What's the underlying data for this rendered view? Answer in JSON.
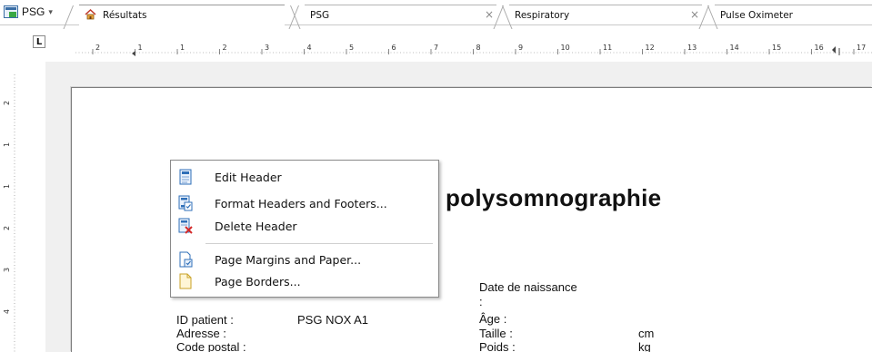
{
  "app": {
    "label": "PSG"
  },
  "tabs": [
    {
      "label": "Résultats",
      "icon": "home-icon",
      "active": true
    },
    {
      "label": "PSG",
      "closable": true
    },
    {
      "label": "Respiratory",
      "closable": true
    },
    {
      "label": "Pulse Oximeter"
    }
  ],
  "ruler": {
    "corner": "L",
    "h_numbers": [
      "2",
      "1",
      "1",
      "2",
      "3",
      "4",
      "5",
      "6",
      "7",
      "8",
      "9",
      "10",
      "11",
      "12",
      "13",
      "14",
      "15",
      "16",
      "17"
    ],
    "v_numbers": [
      "2",
      "1",
      "1",
      "2",
      "3",
      "4"
    ]
  },
  "document": {
    "title": "polysomnographie",
    "patient_id_label": "ID patient :",
    "patient_id_value": "PSG NOX A1",
    "address_label": "Adresse :",
    "postal_label": "Code postal :",
    "dob_label": "Date de naissance",
    "dob_colon": ":",
    "age_label": "Âge :",
    "height_label": "Taille :",
    "height_unit": "cm",
    "weight_label": "Poids :",
    "weight_unit": "kg"
  },
  "context_menu": {
    "items": [
      {
        "label": "Edit Header",
        "icon": "edit-header-icon"
      },
      {
        "label": "Format Headers and Footers...",
        "icon": "format-headers-icon"
      },
      {
        "label": "Delete Header",
        "icon": "delete-header-icon"
      },
      {
        "label": "Page Margins and Paper...",
        "icon": "page-margins-icon"
      },
      {
        "label": "Page Borders...",
        "icon": "page-borders-icon"
      }
    ]
  },
  "colors": {
    "accent": "#3a6ea5",
    "menu_icon_blue": "#2f6fb8",
    "delete_red": "#d42a2a"
  }
}
